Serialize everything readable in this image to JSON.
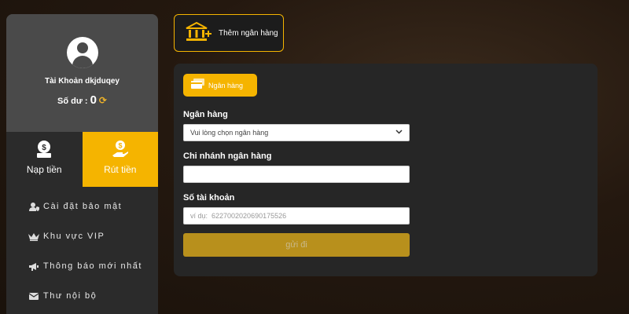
{
  "sidebar": {
    "account_label": "Tài Khoản dkjduqey",
    "balance_label": "Số dư :",
    "balance_value": "0",
    "tabs": {
      "deposit": "Nạp tiền",
      "withdraw": "Rút tiền"
    },
    "menu": [
      {
        "icon": "user-shield-icon",
        "label": "Cài đặt bảo mật"
      },
      {
        "icon": "crown-icon",
        "label": "Khu vực VIP"
      },
      {
        "icon": "megaphone-icon",
        "label": "Thông báo mới nhất"
      },
      {
        "icon": "envelope-icon",
        "label": "Thư nội bộ"
      }
    ]
  },
  "add_bank": {
    "label": "Thêm ngân hàng"
  },
  "form": {
    "chip_label": "Ngân hàng",
    "bank_label": "Ngân hàng",
    "bank_select_value": "Vui lòng chọn ngân hàng",
    "branch_label": "Chi nhánh ngân hàng",
    "branch_value": "",
    "account_label": "Số tài khoản",
    "account_placeholder": "ví dụ:  6227002020690175526",
    "submit_label": "gửi đi"
  },
  "colors": {
    "accent": "#f5b400",
    "panel": "#262626",
    "sidebar": "#2b2b2b",
    "profile": "#4a4a4a"
  }
}
